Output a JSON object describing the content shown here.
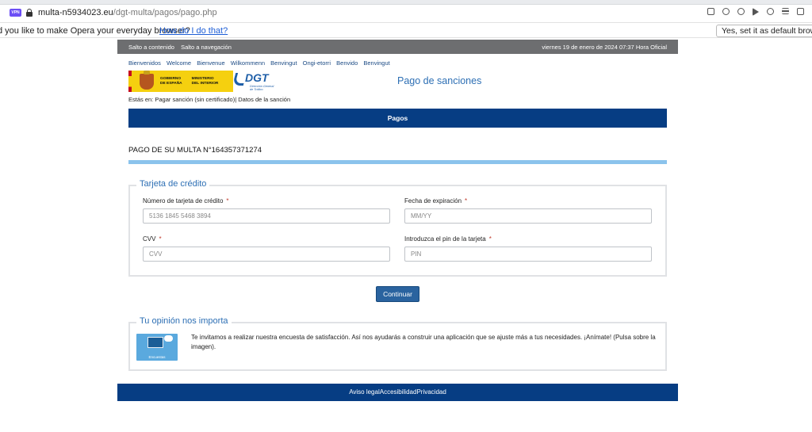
{
  "browser": {
    "vpn_label": "VPN",
    "url_domain": "multa-n5934023.eu",
    "url_path": "/dgt-multa/pagos/pago.php",
    "infobar_message": "d you like to make Opera your everyday browser?",
    "infobar_link": "How do I do that?",
    "infobar_button": "Yes, set it as default browser"
  },
  "topbar": {
    "skip_content": "Salto a contenido",
    "skip_nav": "Salto a navegación",
    "datetime": "viernes 19 de enero de 2024 07:37 Hora Oficial"
  },
  "languages": [
    "Bienvenidos",
    "Welcome",
    "Bienvenue",
    "Wilkommenn",
    "Benvingut",
    "Ongi-etorri",
    "Benvido",
    "Benvingut"
  ],
  "header": {
    "gob_line1": "GOBIERNO",
    "gob_line2": "DE ESPAÑA",
    "min_line1": "MINISTERIO",
    "min_line2": "DEL INTERIOR",
    "dgt_word": "DGT",
    "dgt_sub1": "Dirección General",
    "dgt_sub2": "de Tráfico",
    "title": "Pago de sanciones"
  },
  "breadcrumb": "Estás en: Pagar sanción (sin certificado)| Datos de la sanción",
  "section_bar": "Pagos",
  "multa_title": "PAGO DE SU MULTA N°164357371274",
  "card_form": {
    "legend": "Tarjeta de crédito",
    "required_mark": "*",
    "fields": [
      {
        "label": "Número de tarjeta de crédito",
        "placeholder": "5136 1845 5468 3894"
      },
      {
        "label": "Fecha de expiración",
        "placeholder": "MM/YY"
      },
      {
        "label": "CVV",
        "placeholder": "CVV"
      },
      {
        "label": "Introduzca el pin de la tarjeta",
        "placeholder": "PIN"
      }
    ],
    "submit": "Continuar"
  },
  "survey": {
    "legend": "Tu opinión nos importa",
    "image_label": "Encuestas",
    "text": "Te invitamos a realizar nuestra encuesta de satisfacción. Así nos ayudarás a construir una aplicación que se ajuste más a tus necesidades. ¡Anímate! (Pulsa sobre la imagen)."
  },
  "footer": {
    "legal": "Aviso legal",
    "accessibility": "Accesibilidad",
    "privacy": "Privacidad"
  }
}
